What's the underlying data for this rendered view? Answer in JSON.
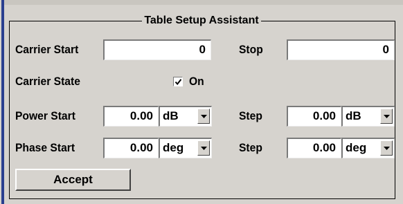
{
  "panel": {
    "title": "Table Setup Assistant"
  },
  "carrier": {
    "start_label": "Carrier Start",
    "start_value": "0",
    "stop_label": "Stop",
    "stop_value": "0"
  },
  "state": {
    "label": "Carrier State",
    "checkbox_label": "On",
    "checked": true
  },
  "power": {
    "start_label": "Power Start",
    "start_value": "0.00",
    "start_unit": "dB",
    "step_label": "Step",
    "step_value": "0.00",
    "step_unit": "dB"
  },
  "phase": {
    "start_label": "Phase Start",
    "start_value": "0.00",
    "start_unit": "deg",
    "step_label": "Step",
    "step_value": "0.00",
    "step_unit": "deg"
  },
  "actions": {
    "accept_label": "Accept"
  },
  "colors": {
    "background": "#d6d3ce",
    "accent": "#2a3f8f"
  },
  "icons": {
    "dropdown": "chevron-down-icon",
    "check": "checkmark-icon"
  }
}
